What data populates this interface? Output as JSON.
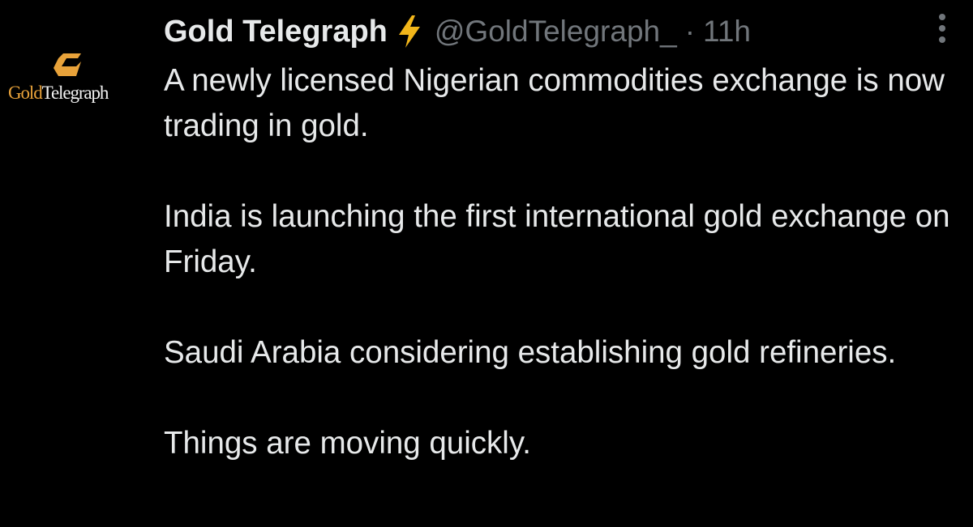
{
  "tweet": {
    "avatar": {
      "wordmark_gold": "Gold",
      "wordmark_rest": "Telegraph",
      "accent_color": "#e8a23a"
    },
    "author": {
      "display_name": "Gold Telegraph",
      "badge_icon": "lightning-bolt-icon",
      "badge_color": "#f2b61a",
      "handle": "@GoldTelegraph_",
      "separator": "·",
      "time": "11h"
    },
    "more_icon": "more-vertical-icon",
    "paragraphs": [
      "A newly licensed Nigerian commodities exchange is now  trading in gold.",
      "India is launching the first international gold exchange on Friday.",
      "Saudi Arabia considering establishing gold refineries.",
      "Things are moving quickly."
    ]
  }
}
